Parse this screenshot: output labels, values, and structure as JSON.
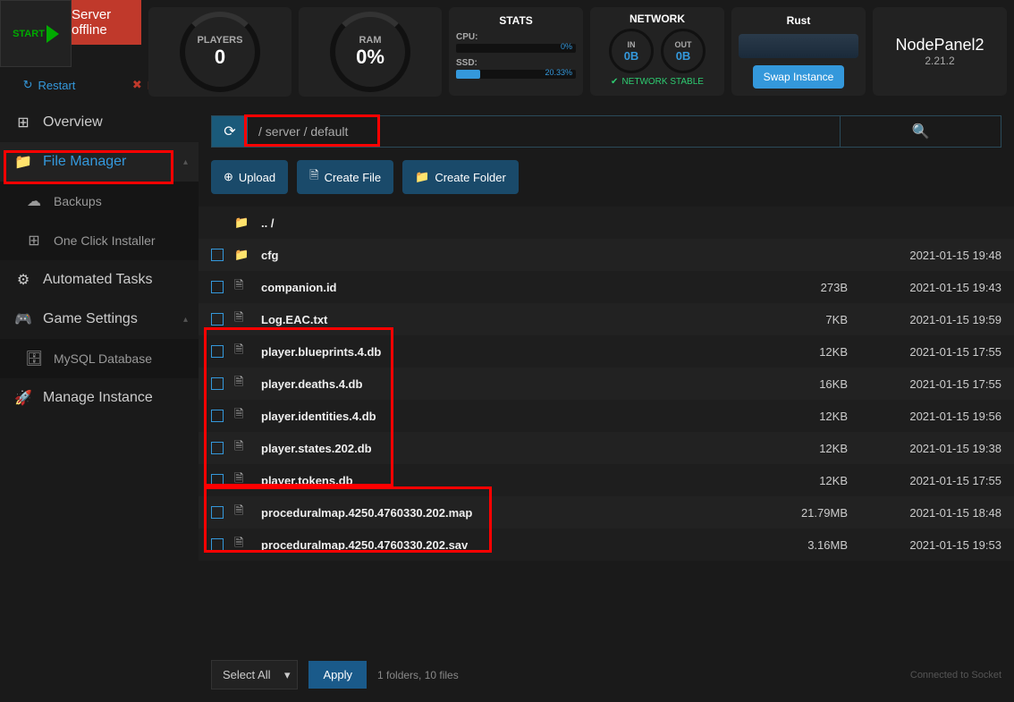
{
  "header": {
    "status": "Server offline",
    "start": "START",
    "restart": "Restart",
    "kill": "Kill"
  },
  "gauges": {
    "players": {
      "label": "PLAYERS",
      "value": "0"
    },
    "ram": {
      "label": "RAM",
      "value": "0%"
    }
  },
  "stats": {
    "title": "STATS",
    "cpu": {
      "label": "CPU:",
      "value": "0%",
      "pct": 0
    },
    "ssd": {
      "label": "SSD:",
      "value": "20.33%",
      "pct": 20.33
    }
  },
  "network": {
    "title": "NETWORK",
    "in": {
      "label": "IN",
      "value": "0B"
    },
    "out": {
      "label": "OUT",
      "value": "0B"
    },
    "status": "NETWORK STABLE"
  },
  "game": {
    "title": "Rust",
    "swap": "Swap Instance"
  },
  "brand": {
    "name": "NodePanel2",
    "version": "2.21.2"
  },
  "sidebar": [
    {
      "icon": "⊞",
      "label": "Overview"
    },
    {
      "icon": "📁",
      "label": "File Manager",
      "active": true,
      "arrow": "▴"
    },
    {
      "icon": "☁",
      "label": "Backups",
      "sub": true
    },
    {
      "icon": "⊞",
      "label": "One Click Installer",
      "sub": true
    },
    {
      "icon": "⚙",
      "label": "Automated Tasks"
    },
    {
      "icon": "🎮",
      "label": "Game Settings",
      "arrow": "▴"
    },
    {
      "icon": "🗄",
      "label": "MySQL Database",
      "sub": true
    },
    {
      "icon": "🚀",
      "label": "Manage Instance"
    }
  ],
  "path": "/   server   /  default",
  "actions": {
    "upload": "Upload",
    "createFile": "Create File",
    "createFolder": "Create Folder"
  },
  "files": [
    {
      "type": "up",
      "name": ".. /"
    },
    {
      "type": "folder",
      "name": "cfg",
      "size": "",
      "date": "2021-01-15 19:48"
    },
    {
      "type": "file",
      "name": "companion.id",
      "size": "273B",
      "date": "2021-01-15 19:43"
    },
    {
      "type": "file",
      "name": "Log.EAC.txt",
      "size": "7KB",
      "date": "2021-01-15 19:59"
    },
    {
      "type": "file",
      "name": "player.blueprints.4.db",
      "size": "12KB",
      "date": "2021-01-15 17:55"
    },
    {
      "type": "file",
      "name": "player.deaths.4.db",
      "size": "16KB",
      "date": "2021-01-15 17:55"
    },
    {
      "type": "file",
      "name": "player.identities.4.db",
      "size": "12KB",
      "date": "2021-01-15 19:56"
    },
    {
      "type": "file",
      "name": "player.states.202.db",
      "size": "12KB",
      "date": "2021-01-15 19:38"
    },
    {
      "type": "file",
      "name": "player.tokens.db",
      "size": "12KB",
      "date": "2021-01-15 17:55"
    },
    {
      "type": "file",
      "name": "proceduralmap.4250.4760330.202.map",
      "size": "21.79MB",
      "date": "2021-01-15 18:48"
    },
    {
      "type": "file",
      "name": "proceduralmap.4250.4760330.202.sav",
      "size": "3.16MB",
      "date": "2021-01-15 19:53"
    }
  ],
  "footer": {
    "selectAll": "Select All",
    "apply": "Apply",
    "info": "1 folders, 10 files",
    "socket": "Connected to Socket"
  }
}
